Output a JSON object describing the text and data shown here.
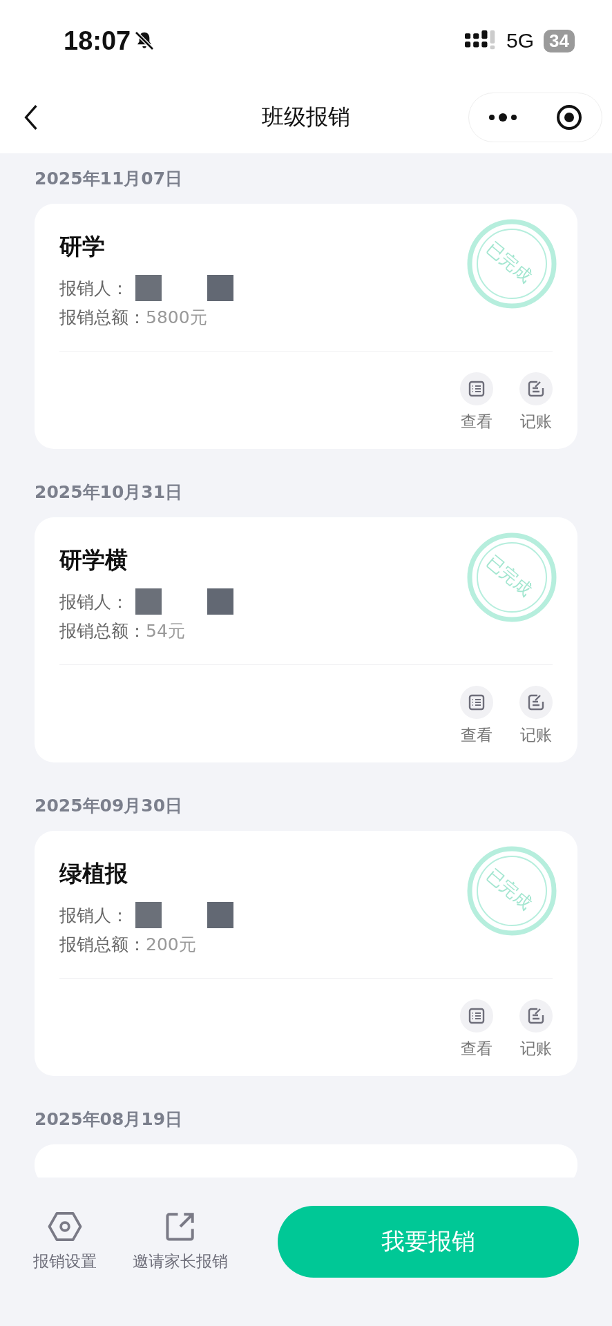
{
  "status_bar": {
    "time": "18:07",
    "network": "5G",
    "battery": "34"
  },
  "nav": {
    "title": "班级报销"
  },
  "records": [
    {
      "date": "2025年11月07日",
      "title": "研学",
      "stamp": "已完成",
      "reimburser_label": "报销人：",
      "name_redacted": true,
      "amount_label": "报销总额：",
      "amount": "5800元",
      "actions": [
        {
          "kind": "view",
          "label": "查看"
        },
        {
          "kind": "bookkeep",
          "label": "记账"
        }
      ]
    },
    {
      "date": "2025年10月31日",
      "title": "研学横",
      "stamp": "已完成",
      "reimburser_label": "报销人：",
      "name_redacted": true,
      "amount_label": "报销总额：",
      "amount": "54元",
      "actions": [
        {
          "kind": "view",
          "label": "查看"
        },
        {
          "kind": "bookkeep",
          "label": "记账"
        }
      ]
    },
    {
      "date": "2025年09月30日",
      "title": "绿植报",
      "stamp": "已完成",
      "reimburser_label": "报销人：",
      "name_redacted": true,
      "amount_label": "报销总额：",
      "amount": "200元",
      "actions": [
        {
          "kind": "view",
          "label": "查看"
        },
        {
          "kind": "bookkeep",
          "label": "记账"
        }
      ]
    }
  ],
  "next_date": "2025年08月19日",
  "bottom": {
    "settings": "报销设置",
    "invite": "邀请家长报销",
    "submit": "我要报销"
  }
}
